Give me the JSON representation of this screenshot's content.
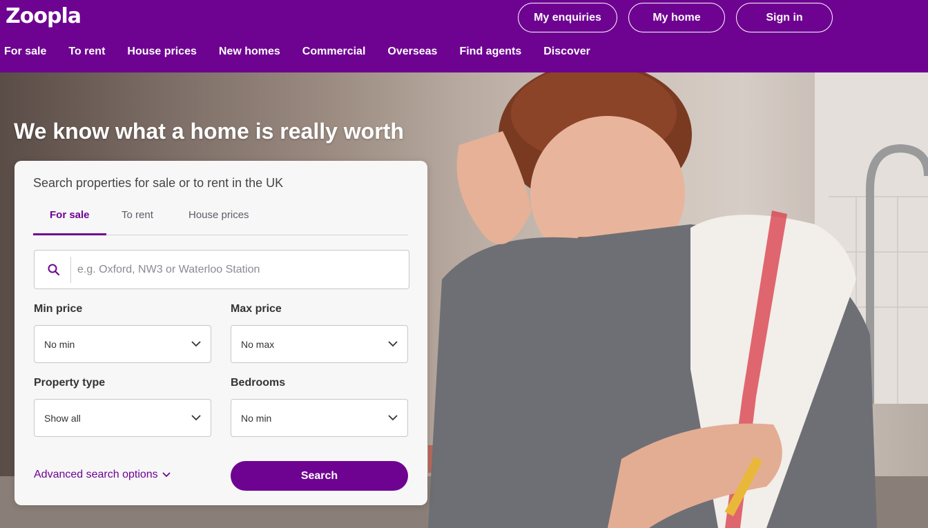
{
  "brand": {
    "logo_text": "Zoopla",
    "primary_color": "#6e0391"
  },
  "header": {
    "buttons": {
      "enquiries": "My enquiries",
      "my_home": "My home",
      "sign_in": "Sign in"
    },
    "nav": [
      "For sale",
      "To rent",
      "House prices",
      "New homes",
      "Commercial",
      "Overseas",
      "Find agents",
      "Discover"
    ]
  },
  "hero": {
    "title": "We know what a home is really worth"
  },
  "search_card": {
    "heading": "Search properties for sale or to rent in the UK",
    "tabs": {
      "for_sale": "For sale",
      "to_rent": "To rent",
      "house_prices": "House prices"
    },
    "active_tab": "For sale",
    "search": {
      "placeholder": "e.g. Oxford, NW3 or Waterloo Station",
      "value": ""
    },
    "min_price": {
      "label": "Min price",
      "value": "No min"
    },
    "max_price": {
      "label": "Max price",
      "value": "No max"
    },
    "property_type": {
      "label": "Property type",
      "value": "Show all"
    },
    "bedrooms": {
      "label": "Bedrooms",
      "value": "No min"
    },
    "advanced_label": "Advanced search options",
    "search_button": "Search"
  }
}
